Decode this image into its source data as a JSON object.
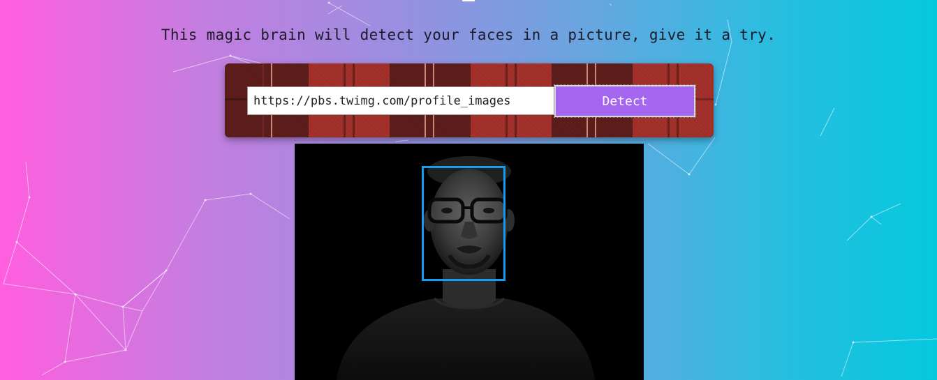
{
  "header": {
    "tagline": "This magic brain will detect your faces in a picture, give it a try."
  },
  "form": {
    "url_value": "https://pbs.twimg.com/profile_images",
    "detect_label": "Detect"
  },
  "result": {
    "faces_detected": 1,
    "box_color": "#149df2"
  },
  "theme": {
    "gradient_start": "#ff5edf",
    "gradient_end": "#04c8de",
    "button_color": "#a566ef"
  }
}
